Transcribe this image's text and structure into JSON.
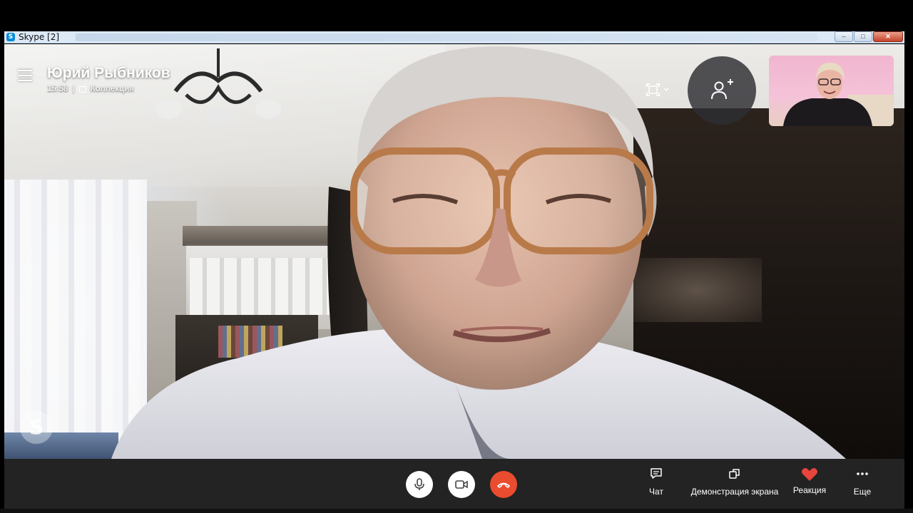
{
  "window": {
    "title": "Skype [2]",
    "app_icon": "S"
  },
  "call": {
    "contact_name": "Юрий Рыбников",
    "time": "15:58",
    "separator": "|",
    "gallery_label": "Коллекция"
  },
  "watermark": {
    "glyph": "S"
  },
  "toolbar": {
    "chat_label": "Чат",
    "share_screen_label": "Демонстрация экрана",
    "reaction_label": "Реакция",
    "more_label": "Еще"
  },
  "colors": {
    "end_call": "#e94c2f",
    "reaction_heart": "#e8453c",
    "callbar_bg": "#232323"
  },
  "icons": {
    "menu": "hamburger-icon",
    "fullscreen": "fullscreen-icon",
    "add_person": "add-person-icon",
    "mic": "microphone-icon",
    "camera": "video-camera-icon",
    "end_call": "end-call-icon",
    "chat": "chat-icon",
    "share_screen": "share-screen-icon",
    "reaction": "heart-icon",
    "more": "more-icon"
  }
}
